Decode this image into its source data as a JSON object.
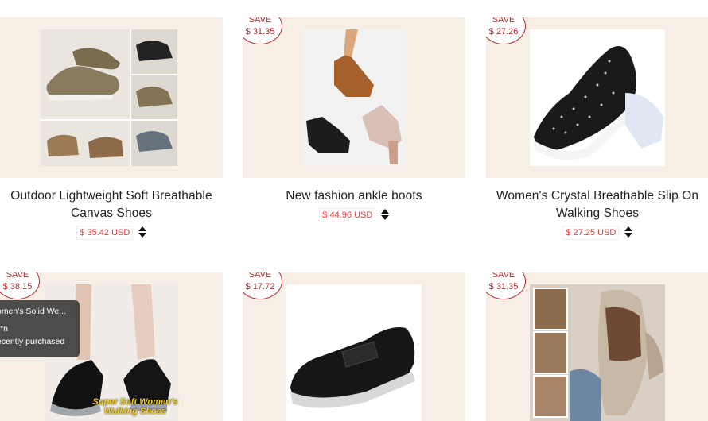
{
  "products": [
    {
      "title": "Outdoor Lightweight Soft Breathable Canvas Shoes",
      "price": "$ 35.42 USD",
      "save": null,
      "image_icon": "sneaker-collage-image"
    },
    {
      "title": "New fashion ankle boots",
      "price": "$ 44.96 USD",
      "save": {
        "label": "SAVE",
        "amount": "$ 31.35"
      },
      "image_icon": "ankle-boots-image"
    },
    {
      "title": "Women's Crystal Breathable Slip On Walking Shoes",
      "price": "$ 27.25 USD",
      "save": {
        "label": "SAVE",
        "amount": "$ 27.26"
      },
      "image_icon": "crystal-slip-on-image"
    },
    {
      "title": "",
      "price": "",
      "save": {
        "label": "SAVE",
        "amount": "$ 38.15"
      },
      "image_icon": "walking-shoes-image",
      "image_caption_1": "Super Soft Women's",
      "image_caption_2": "Walking Shoes"
    },
    {
      "title": "",
      "price": "",
      "save": {
        "label": "SAVE",
        "amount": "$ 17.72"
      },
      "image_icon": "black-slip-on-image"
    },
    {
      "title": "",
      "price": "",
      "save": {
        "label": "SAVE",
        "amount": "$ 31.35"
      },
      "image_icon": "sandals-image"
    }
  ],
  "toast": {
    "line1": "omen's Solid We...",
    "line2": "**n",
    "line3": "ecently purchased"
  },
  "colors": {
    "card_bg": "#f7efe6",
    "save_red": "#b3282d",
    "price_red": "#e03c3c"
  }
}
